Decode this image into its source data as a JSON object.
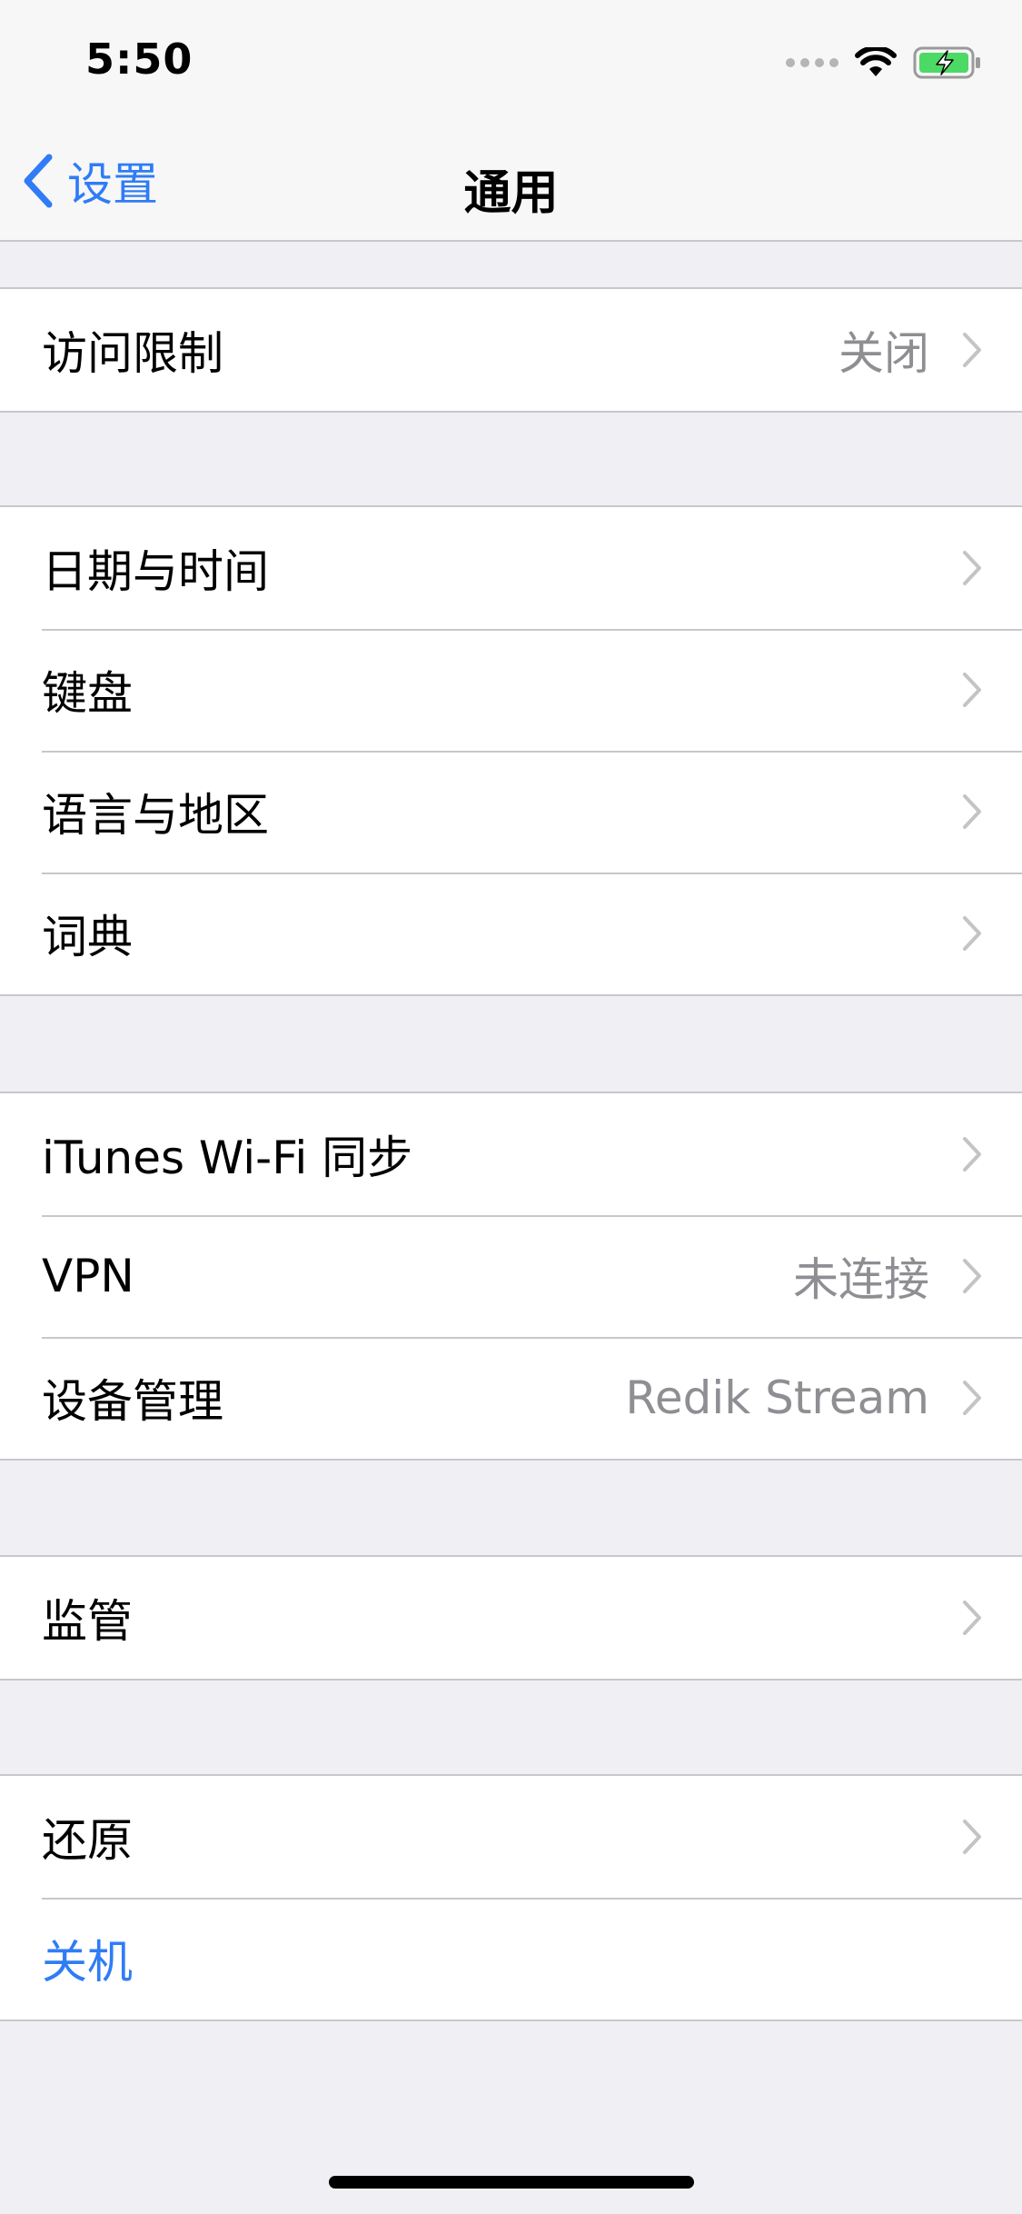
{
  "status_bar": {
    "time": "5:50",
    "icons": [
      "signal-dots-icon",
      "wifi-icon",
      "battery-charging-icon"
    ],
    "battery_color": "#4cd964"
  },
  "nav": {
    "back_label": "设置",
    "title": "通用",
    "accent_color": "#2f7cf6"
  },
  "groups": [
    {
      "items": [
        {
          "label": "访问限制",
          "value": "关闭"
        }
      ]
    },
    {
      "items": [
        {
          "label": "日期与时间"
        },
        {
          "label": "键盘"
        },
        {
          "label": "语言与地区"
        },
        {
          "label": "词典"
        }
      ]
    },
    {
      "items": [
        {
          "label": "iTunes Wi-Fi 同步"
        },
        {
          "label": "VPN",
          "value": "未连接"
        },
        {
          "label": "设备管理",
          "value": "Redik Stream"
        }
      ]
    },
    {
      "items": [
        {
          "label": "监管"
        }
      ]
    },
    {
      "items": [
        {
          "label": "还原"
        },
        {
          "label": "关机",
          "style": "action"
        }
      ]
    }
  ]
}
